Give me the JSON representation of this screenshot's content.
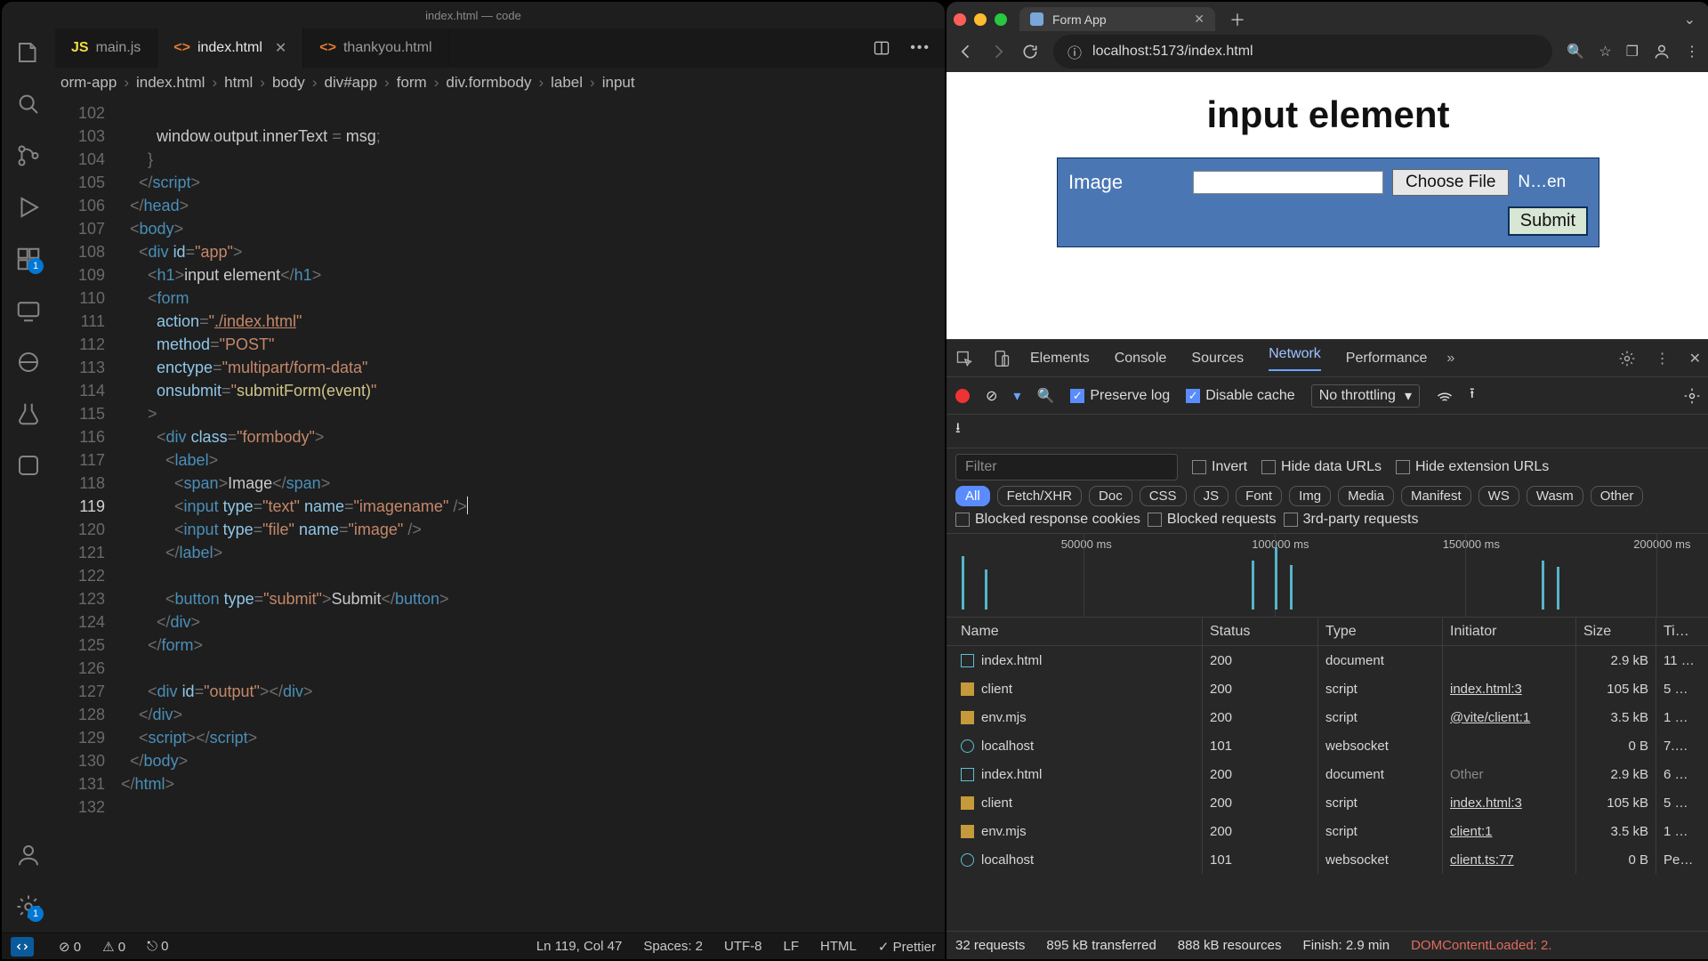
{
  "vscode": {
    "window_title": "index.html — code",
    "tabs": [
      {
        "label": "main.js",
        "icon": "JS",
        "active": false,
        "close": false
      },
      {
        "label": "index.html",
        "icon": "<>",
        "active": true,
        "close": true
      },
      {
        "label": "thankyou.html",
        "icon": "<>",
        "active": false,
        "close": false
      }
    ],
    "activity_badge_ext": "1",
    "activity_badge_settings": "1",
    "breadcrumb": [
      "orm-app",
      "index.html",
      "html",
      "body",
      "div#app",
      "form",
      "div.formbody",
      "label",
      "input"
    ],
    "gutter_start": 102,
    "current_line": 119,
    "last_line": 132,
    "status": {
      "errors": "0",
      "warnings": "0",
      "ports": "0",
      "ln_col": "Ln 119, Col 47",
      "spaces": "Spaces: 2",
      "encoding": "UTF-8",
      "eol": "LF",
      "lang": "HTML",
      "prettier": "Prettier"
    }
  },
  "browser": {
    "tab_title": "Form App",
    "url": "localhost:5173/index.html",
    "page": {
      "heading": "input element",
      "field_label": "Image",
      "choose_file": "Choose File",
      "file_state": "N…en",
      "submit": "Submit"
    }
  },
  "devtools": {
    "tabs": [
      "Elements",
      "Console",
      "Sources",
      "Network",
      "Performance"
    ],
    "active_tab": "Network",
    "preserve_log": "Preserve log",
    "disable_cache": "Disable cache",
    "throttling": "No throttling",
    "filter_placeholder": "Filter",
    "invert": "Invert",
    "hide_data_urls": "Hide data URLs",
    "hide_ext_urls": "Hide extension URLs",
    "type_chips": [
      "All",
      "Fetch/XHR",
      "Doc",
      "CSS",
      "JS",
      "Font",
      "Img",
      "Media",
      "Manifest",
      "WS",
      "Wasm",
      "Other"
    ],
    "blocked_cookies": "Blocked response cookies",
    "blocked_requests": "Blocked requests",
    "third_party": "3rd-party requests",
    "timeline_labels": [
      "50000 ms",
      "100000 ms",
      "150000 ms",
      "200000 ms"
    ],
    "columns": [
      "Name",
      "Status",
      "Type",
      "Initiator",
      "Size",
      "Ti…"
    ],
    "rows": [
      {
        "name": "index.html",
        "kind": "doc",
        "status": "200",
        "type": "document",
        "initiator": "",
        "size": "2.9 kB",
        "time": "11 …"
      },
      {
        "name": "client",
        "kind": "script",
        "status": "200",
        "type": "script",
        "initiator": "index.html:3",
        "size": "105 kB",
        "time": "5 …"
      },
      {
        "name": "env.mjs",
        "kind": "script",
        "status": "200",
        "type": "script",
        "initiator": "@vite/client:1",
        "size": "3.5 kB",
        "time": "1 …"
      },
      {
        "name": "localhost",
        "kind": "ws",
        "status": "101",
        "type": "websocket",
        "initiator": "",
        "size": "0 B",
        "time": "7.…"
      },
      {
        "name": "index.html",
        "kind": "doc",
        "status": "200",
        "type": "document",
        "initiator": "Other",
        "initiator_muted": true,
        "size": "2.9 kB",
        "time": "6 …"
      },
      {
        "name": "client",
        "kind": "script",
        "status": "200",
        "type": "script",
        "initiator": "index.html:3",
        "size": "105 kB",
        "time": "5 …"
      },
      {
        "name": "env.mjs",
        "kind": "script",
        "status": "200",
        "type": "script",
        "initiator": "client:1",
        "size": "3.5 kB",
        "time": "1 …"
      },
      {
        "name": "localhost",
        "kind": "ws",
        "status": "101",
        "type": "websocket",
        "initiator": "client.ts:77",
        "size": "0 B",
        "time": "Pe…"
      }
    ],
    "footer": {
      "requests": "32 requests",
      "transferred": "895 kB transferred",
      "resources": "888 kB resources",
      "finish": "Finish: 2.9 min",
      "dcl": "DOMContentLoaded: 2."
    }
  }
}
